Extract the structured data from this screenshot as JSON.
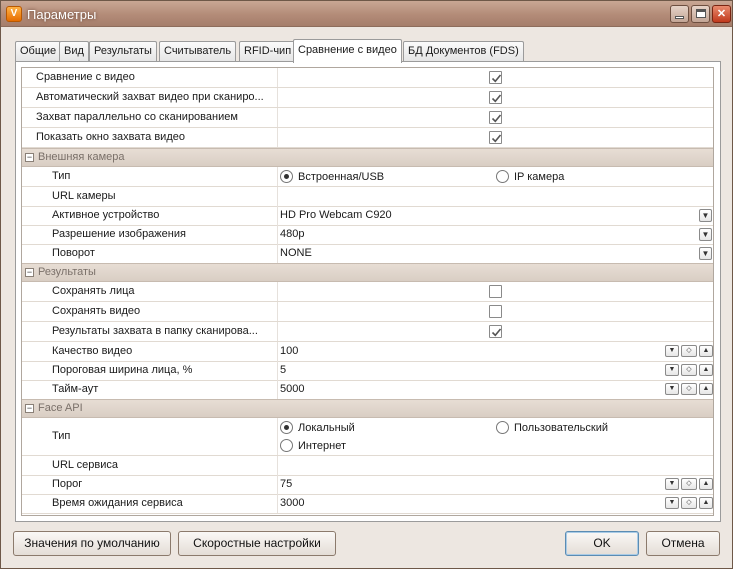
{
  "window": {
    "title": "Параметры",
    "app_icon": "V"
  },
  "tabs": [
    {
      "label": "Общие"
    },
    {
      "label": "Вид"
    },
    {
      "label": "Результаты"
    },
    {
      "label": "Считыватель"
    },
    {
      "label": "RFID-чип"
    },
    {
      "label": "Сравнение с видео",
      "active": true
    },
    {
      "label": "БД Документов (FDS)"
    }
  ],
  "general": {
    "compare_video": {
      "label": "Сравнение с видео",
      "checked": true
    },
    "auto_capture": {
      "label": "Автоматический захват видео при сканиро...",
      "checked": true
    },
    "parallel_capture": {
      "label": "Захват параллельно со сканированием",
      "checked": true
    },
    "show_window": {
      "label": "Показать окно захвата видео",
      "checked": true
    }
  },
  "camera": {
    "section": "Внешняя камера",
    "type_label": "Тип",
    "type_opt1": "Встроенная/USB",
    "type_opt2": "IP камера",
    "url_label": "URL камеры",
    "url_value": "",
    "device_label": "Активное устройство",
    "device_value": "HD Pro Webcam C920",
    "resolution_label": "Разрешение изображения",
    "resolution_value": "480p",
    "rotation_label": "Поворот",
    "rotation_value": "NONE"
  },
  "results": {
    "section": "Результаты",
    "save_faces": {
      "label": "Сохранять лица",
      "checked": false
    },
    "save_video": {
      "label": "Сохранять видео",
      "checked": false
    },
    "results_folder": {
      "label": "Результаты захвата в папку сканирова...",
      "checked": true
    },
    "quality_label": "Качество видео",
    "quality_value": "100",
    "threshold_label": "Пороговая ширина лица, %",
    "threshold_value": "5",
    "timeout_label": "Тайм-аут",
    "timeout_value": "5000"
  },
  "faceapi": {
    "section": "Face API",
    "type_label": "Тип",
    "opt_local": "Локальный",
    "opt_custom": "Пользовательский",
    "opt_internet": "Интернет",
    "service_url_label": "URL сервиса",
    "service_url_value": "",
    "threshold_label": "Порог",
    "threshold_value": "75",
    "wait_label": "Время ожидания сервиса",
    "wait_value": "3000"
  },
  "buttons": {
    "defaults": "Значения по умолчанию",
    "quick": "Скоростные настройки",
    "ok": "OK",
    "cancel": "Отмена"
  }
}
